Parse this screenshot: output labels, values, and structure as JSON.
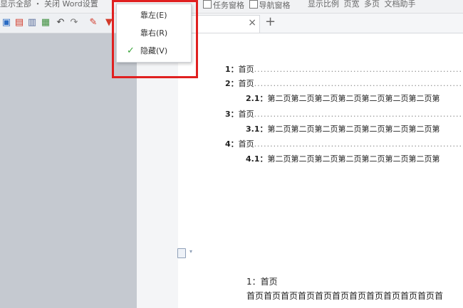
{
  "top_bar": {
    "left_text": "显示全部 ・ 关闭 Word设置",
    "middle_items": [
      "任务窗格",
      "导航窗格"
    ],
    "right_items": [
      "显示比例",
      "页宽",
      "多页",
      "文档助手"
    ]
  },
  "tabs": {
    "close": "×",
    "add": "+"
  },
  "toc": [
    {
      "num": "1：",
      "text": "首页",
      "indent": 0
    },
    {
      "num": "2：",
      "text": "首页",
      "indent": 0
    },
    {
      "num": "2.1：",
      "text": "第二页第二页第二页第二页第二页第二页第二页第",
      "indent": 1
    },
    {
      "num": "3：",
      "text": "首页",
      "indent": 0
    },
    {
      "num": "3.1：",
      "text": "第二页第二页第二页第二页第二页第二页第二页第",
      "indent": 1
    },
    {
      "num": "4：",
      "text": "首页",
      "indent": 0
    },
    {
      "num": "4.1：",
      "text": "第二页第二页第二页第二页第二页第二页第二页第",
      "indent": 1
    }
  ],
  "body": {
    "heading_num": "1：",
    "heading_text": "首页",
    "paragraph": "首页首页首页首页首页首页首页首页首页首页首页首"
  },
  "context_menu": {
    "items": [
      {
        "label": "靠左(E)",
        "checked": false
      },
      {
        "label": "靠右(R)",
        "checked": false
      },
      {
        "label": "隐藏(V)",
        "checked": true
      }
    ],
    "check_mark": "✓"
  },
  "colors": {
    "highlight_border": "#e02020",
    "nav_pane": "#c5c9d0",
    "check": "#3aa53a"
  },
  "icons": [
    "save-icon",
    "pdf-icon",
    "print-icon",
    "print-preview-icon",
    "undo-icon",
    "redo-icon",
    "format-painter-icon",
    "filter-icon"
  ]
}
